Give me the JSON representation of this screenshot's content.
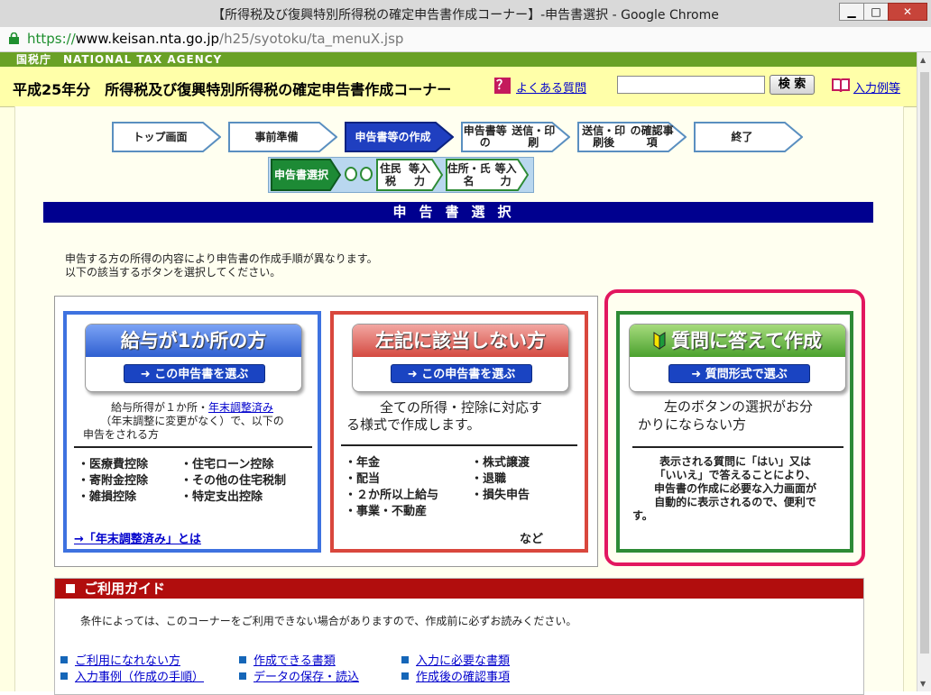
{
  "window": {
    "title": "【所得税及び復興特別所得税の確定申告書作成コーナー】-申告書選択 - Google Chrome",
    "url_scheme": "https://",
    "url_host": "www.keisan.nta.go.jp",
    "url_path": "/h25/syotoku/ta_menuX.jsp"
  },
  "nta_bar": "国税庁　NATIONAL TAX AGENCY",
  "header": {
    "title": "平成25年分　所得税及び復興特別所得税の確定申告書作成コーナー",
    "faq_icon": "？",
    "faq_link": "よくある質問",
    "search_value": "",
    "search_button": "検 索",
    "examples_link": "入力例等"
  },
  "steps": [
    {
      "label": "トップ画面",
      "active": false
    },
    {
      "label": "事前準備",
      "active": false
    },
    {
      "label": "申告書等の\n作成",
      "active": true
    },
    {
      "label": "申告書等の\n送信・印刷",
      "active": false
    },
    {
      "label": "送信・印刷後\nの確認事項",
      "active": false
    },
    {
      "label": "終了",
      "active": false
    }
  ],
  "substeps": [
    {
      "label": "申告書\n選択",
      "active": true
    },
    {
      "label": "住民税\n等入力",
      "active": false
    },
    {
      "label": "住所・氏名\n等入力",
      "active": false
    }
  ],
  "section_title": "申告書選択",
  "intro": {
    "line1": "申告する方の所得の内容により申告書の作成手順が異なります。",
    "line2": "以下の該当するボタンを選択してください。"
  },
  "panels": {
    "salary": {
      "title": "給与が1か所の方",
      "button": "➜ この申告書を選ぶ",
      "desc_a": "給与所得が１か所・",
      "desc_link": "年末調整済み",
      "desc_b": "（年末調整に変更がなく）で、以下の",
      "desc_c": "申告をされる方",
      "items_left": [
        "・医療費控除",
        "・寄附金控除",
        "・雑損控除"
      ],
      "items_right": [
        "・住宅ローン控除",
        "・その他の住宅税制",
        "・特定支出控除"
      ],
      "bottom_link": "→「年末調整済み」とは"
    },
    "other": {
      "title": "左記に該当しない方",
      "button": "➜ この申告書を選ぶ",
      "desc_1": "全ての所得・控除に対応す",
      "desc_2": "る様式で作成します。",
      "items_left": [
        "・年金",
        "・配当",
        "・２か所以上給与",
        "・事業・不動産"
      ],
      "items_right": [
        "・株式譲渡",
        "・退職",
        "・損失申告"
      ],
      "etc": "など"
    },
    "question": {
      "title": "質問に答えて作成",
      "button": "➜ 質問形式で選ぶ",
      "desc_1": "左のボタンの選択がお分",
      "desc_2": "かりにならない方",
      "note_1": "表示される質問に「はい」又は",
      "note_2": "「いいえ」で答えることにより、",
      "note_3": "申告書の作成に必要な入力画面が",
      "note_4": "自動的に表示されるので、便利で",
      "note_5": "す。"
    }
  },
  "guide": {
    "title": "ご利用ガイド",
    "note": "条件によっては、このコーナーをご利用できない場合がありますので、作成前に必ずお読みください。",
    "links": [
      "ご利用になれない方",
      "作成できる書類",
      "入力に必要な書類",
      "入力事例（作成の手順）",
      "データの保存・読込",
      "作成後の確認事項"
    ]
  },
  "colors": {
    "nta_green": "#6aa126",
    "section_blue": "#00008f",
    "guide_red": "#b10d0d",
    "panel_blue": "#3e72e0",
    "panel_red": "#d9473d",
    "panel_green": "#2d8b35",
    "highlight_pink": "#e2175f"
  }
}
